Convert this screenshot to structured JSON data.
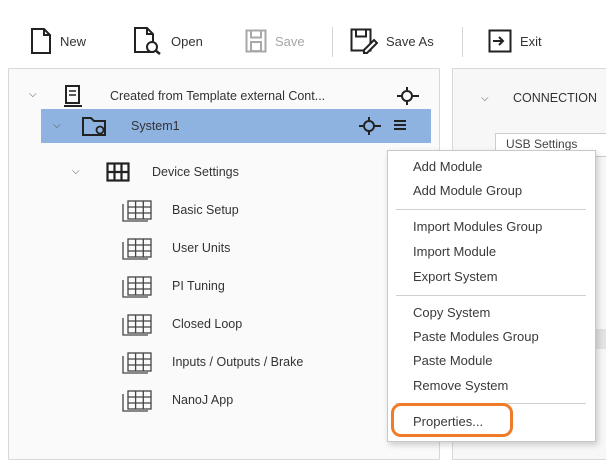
{
  "toolbar": {
    "new_label": "New",
    "open_label": "Open",
    "save_label": "Save",
    "save_as_label": "Save As",
    "exit_label": "Exit"
  },
  "tree": {
    "root_label": "Created from Template external Cont...",
    "system_label": "System1",
    "device_settings_label": "Device Settings",
    "children": [
      "Basic Setup",
      "User Units",
      "PI Tuning",
      "Closed Loop",
      "Inputs / Outputs / Brake",
      "NanoJ App"
    ]
  },
  "right_panel": {
    "header_label": "CONNECTION",
    "tab_label": "USB Settings"
  },
  "context_menu": {
    "items": [
      "Add Module",
      "Add Module Group",
      "Import Modules Group",
      "Import Module",
      "Export System",
      "Copy System",
      "Paste Modules Group",
      "Paste Module",
      "Remove System",
      "Properties..."
    ]
  },
  "colors": {
    "selection": "#8fb3e0",
    "highlight_ring": "#f07c2a"
  }
}
